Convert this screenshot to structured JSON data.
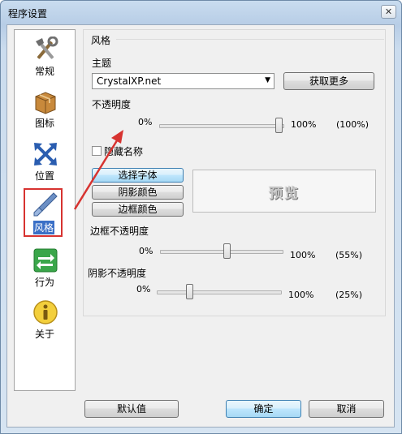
{
  "window": {
    "title": "程序设置",
    "close_glyph": "✕"
  },
  "sidebar": {
    "items": [
      {
        "label": "常规",
        "icon": "tools-icon"
      },
      {
        "label": "图标",
        "icon": "package-icon"
      },
      {
        "label": "位置",
        "icon": "move-arrows-icon"
      },
      {
        "label": "风格",
        "icon": "brush-icon"
      },
      {
        "label": "行为",
        "icon": "switch-arrows-icon"
      },
      {
        "label": "关于",
        "icon": "info-icon"
      }
    ],
    "active_index": 3
  },
  "style": {
    "section_title": "风格",
    "theme_label": "主题",
    "theme_value": "CrystalXP.net",
    "get_more_label": "获取更多",
    "opacity": {
      "label": "不透明度",
      "min": "0%",
      "max": "100%",
      "value_text": "(100%)",
      "value": 100
    },
    "hide_names_label": "隐藏名称",
    "hide_names_checked": false,
    "select_font_label": "选择字体",
    "shadow_color_label": "阴影颜色",
    "border_color_label": "边框颜色",
    "preview_text": "预览",
    "border_opacity": {
      "label": "边框不透明度",
      "min": "0%",
      "max": "100%",
      "value_text": "(55%)",
      "value": 55
    },
    "shadow_opacity": {
      "label": "阴影不透明度",
      "min": "0%",
      "max": "100%",
      "value_text": "(25%)",
      "value": 25
    }
  },
  "footer": {
    "default_label": "默认值",
    "ok_label": "确定",
    "cancel_label": "取消"
  },
  "colors": {
    "annotation_red": "#d73330",
    "selection_blue": "#3a6fc6"
  }
}
